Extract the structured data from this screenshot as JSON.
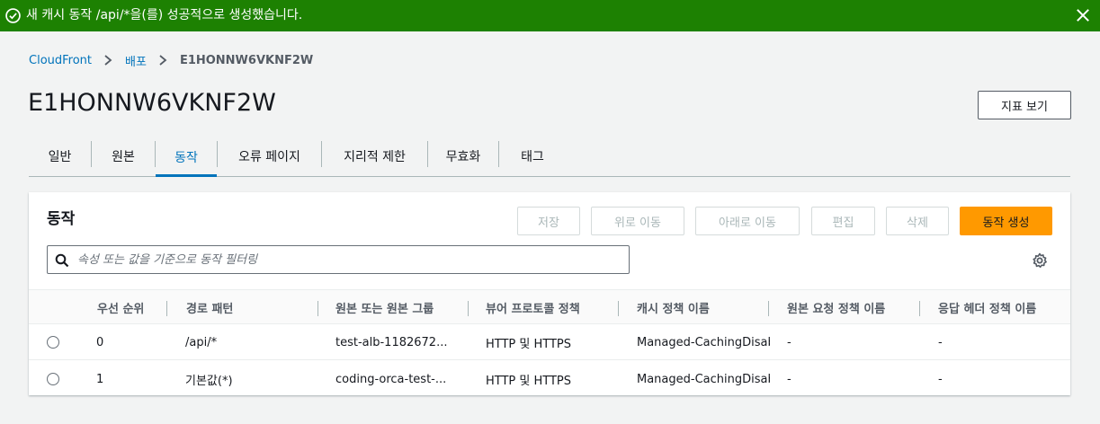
{
  "flash": {
    "message": "새 캐시 동작 /api/*을(를) 성공적으로 생성했습니다.",
    "type": "success",
    "color": "#1d8102"
  },
  "breadcrumb": {
    "items": [
      "CloudFront",
      "배포"
    ],
    "current": "E1HONNW6VKNF2W"
  },
  "page": {
    "title": "E1HONNW6VKNF2W",
    "metrics_button": "지표 보기"
  },
  "tabs": [
    {
      "label": "일반",
      "active": false
    },
    {
      "label": "원본",
      "active": false
    },
    {
      "label": "동작",
      "active": true
    },
    {
      "label": "오류 페이지",
      "active": false
    },
    {
      "label": "지리적 제한",
      "active": false
    },
    {
      "label": "무효화",
      "active": false
    },
    {
      "label": "태그",
      "active": false
    }
  ],
  "behaviors": {
    "title": "동작",
    "buttons": {
      "save": "저장",
      "move_up": "위로 이동",
      "move_down": "아래로 이동",
      "edit": "편집",
      "delete": "삭제",
      "create": "동작 생성"
    },
    "search_placeholder": "속성 또는 값을 기준으로 동작 필터링",
    "columns": [
      "우선 순위",
      "경로 패턴",
      "원본 또는 원본 그룹",
      "뷰어 프로토콜 정책",
      "캐시 정책 이름",
      "원본 요청 정책 이름",
      "응답 헤더 정책 이름"
    ],
    "rows": [
      {
        "priority": "0",
        "path": "/api/*",
        "origin": "test-alb-1182672...",
        "viewer_protocol": "HTTP 및 HTTPS",
        "cache_policy": "Managed-CachingDisab",
        "origin_request_policy": "-",
        "response_headers_policy": "-"
      },
      {
        "priority": "1",
        "path": "기본값(*)",
        "origin": "coding-orca-test-...",
        "viewer_protocol": "HTTP 및 HTTPS",
        "cache_policy": "Managed-CachingDisab",
        "origin_request_policy": "-",
        "response_headers_policy": "-"
      }
    ]
  },
  "colors": {
    "accent": "#0073bb",
    "primary_button": "#ff9900",
    "success": "#1d8102"
  }
}
